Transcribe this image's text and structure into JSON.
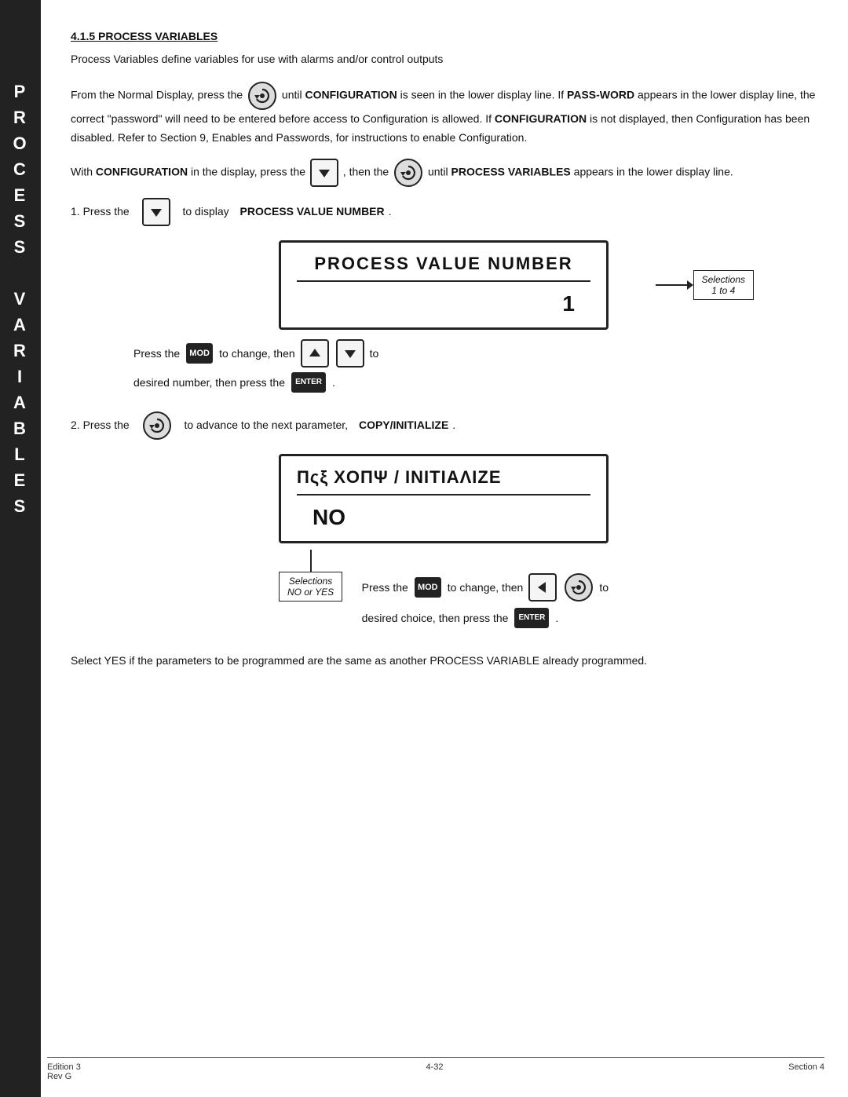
{
  "sidebar": {
    "letters": [
      "P",
      "R",
      "O",
      "C",
      "E",
      "S",
      "S",
      "",
      "V",
      "A",
      "R",
      "I",
      "A",
      "B",
      "L",
      "E",
      "S"
    ]
  },
  "section": {
    "heading": "4.1.5  PROCESS VARIABLES",
    "intro": "Process Variables define variables for use with alarms and/or control outputs",
    "para1_pre": "From the Normal Display, press the",
    "para1_mid": "until",
    "para1_bold1": "CONFIGURATION",
    "para1_mid2": "is seen in the lower display line.  If",
    "para1_bold2": "PASS-WORD",
    "para1_rest": "appears in the lower display line, the correct \"password\" will need to be entered before access to Configuration is allowed.  If",
    "para1_bold3": "CONFIGURATION",
    "para1_rest2": "is not displayed, then Configuration has been disabled.  Refer to Section 9, Enables and Passwords, for instructions to enable Configuration.",
    "para2_pre": "With",
    "para2_bold1": "CONFIGURATION",
    "para2_mid": "in the display, press the",
    "para2_mid2": ", then the",
    "para2_end_bold": "PROCESS VARIABLES",
    "para2_end": "appears in the lower display line.",
    "step1_pre": "1.   Press the",
    "step1_post": "to display",
    "step1_bold": "PROCESS VALUE NUMBER",
    "pvn_box_title": "PROCESS  VALUE  NUMBER",
    "pvn_box_value": "1",
    "pvn_sel_label": "Selections",
    "pvn_sel_range": "1 to 4",
    "mod_label": "MOD",
    "enter_label": "ENTER",
    "controls_pre": "Press the",
    "controls_mid": "to change, then",
    "controls_mid2": "to",
    "controls_end": "desired number, then press the",
    "step2_pre": "2.   Press the",
    "step2_post": "to advance to the next parameter,",
    "step2_bold": "COPY/INITIALIZE",
    "copy_box_title": "Πςξ  ΧΟΠΨ / ΙNΙΤΙΑΛΙΖΕ",
    "copy_box_value": "NO",
    "sel_label2": "Selections",
    "sel_range2": "NO or YES",
    "press_mod": "Press the",
    "mod_label2": "MOD",
    "change_then": "to change, then",
    "to_desired": "to",
    "desired_choice": "desired choice, then press the",
    "final_para": "Select YES if the parameters to be programmed are the same as another PROCESS VARIABLE already programmed.",
    "footer_left1": "Edition 3",
    "footer_left2": "Rev G",
    "footer_center": "4-32",
    "footer_right": "Section 4"
  }
}
